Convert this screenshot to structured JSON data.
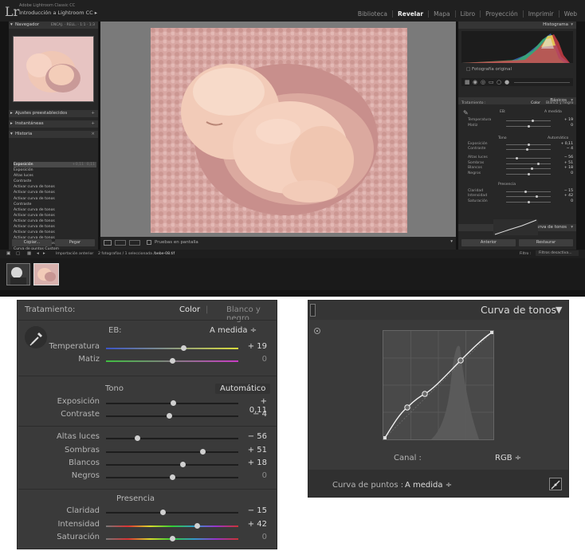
{
  "app": {
    "product": "Adobe Lightroom Classic CC",
    "catalog": "Introducción a Lightroom CC",
    "modules": [
      "Biblioteca",
      "Revelar",
      "Mapa",
      "Libro",
      "Proyección",
      "Imprimir",
      "Web"
    ],
    "active_module": "Revelar"
  },
  "left_panel": {
    "navigator": {
      "title": "Navegador",
      "zoom_options": [
        "ENCAJ.",
        "RELL.",
        "1:1",
        "1:3"
      ]
    },
    "presets_title": "Ajustes preestablecidos",
    "snapshots_title": "Instantáneas",
    "history_title": "Historia",
    "history": [
      {
        "label": "Exposición",
        "v1": "+0,11",
        "v2": "0,11",
        "selected": true
      },
      {
        "label": "Exposición",
        "v1": "",
        "v2": ""
      },
      {
        "label": "Altas luces",
        "v1": "",
        "v2": ""
      },
      {
        "label": "Contraste",
        "v1": "",
        "v2": ""
      },
      {
        "label": "Activar curva de tonos",
        "v1": "",
        "v2": ""
      },
      {
        "label": "Activar curva de tonos",
        "v1": "",
        "v2": ""
      },
      {
        "label": "Activar curva de tonos",
        "v1": "",
        "v2": ""
      },
      {
        "label": "Contraste",
        "v1": "",
        "v2": ""
      },
      {
        "label": "Activar curva de tonos",
        "v1": "",
        "v2": ""
      },
      {
        "label": "Activar curva de tonos",
        "v1": "",
        "v2": ""
      },
      {
        "label": "Activar curva de tonos",
        "v1": "",
        "v2": ""
      },
      {
        "label": "Activar curva de tonos",
        "v1": "",
        "v2": ""
      },
      {
        "label": "Activar curva de tonos",
        "v1": "",
        "v2": ""
      },
      {
        "label": "Activar curva de tonos",
        "v1": "",
        "v2": ""
      },
      {
        "label": "Activar curva de tonos",
        "v1": "",
        "v2": ""
      },
      {
        "label": "Curva de puntos Custom",
        "v1": "",
        "v2": ""
      }
    ],
    "copy_button": "Copiar...",
    "paste_button": "Pegar"
  },
  "toolbar": {
    "soft_proof": "Pruebas en pantalla"
  },
  "filmstrip": {
    "source": "Importación anterior",
    "count": "2 fotografías / 1 seleccionada /",
    "filename": "bebe-08.tif",
    "filter_label": "Filtro :",
    "filter_value": "Filtros desactiva..."
  },
  "right_panel": {
    "histogram_title": "Histograma",
    "original_photo": "Fotografía original",
    "basics_title": "Básicos",
    "treatment_label": "Tratamiento :",
    "treatment_color": "Color",
    "treatment_bw": "Blanco y negro",
    "wb_label": "EB:",
    "wb_value": "A medida",
    "rows": [
      {
        "label": "Temperatura",
        "value": "+ 19"
      },
      {
        "label": "Matiz",
        "value": "0"
      },
      {
        "label": "Exposición",
        "value": "+ 0,11"
      },
      {
        "label": "Contraste",
        "value": "− 4"
      },
      {
        "label": "Altas luces",
        "value": "− 56"
      },
      {
        "label": "Sombras",
        "value": "+ 51"
      },
      {
        "label": "Blancos",
        "value": "+ 18"
      },
      {
        "label": "Negros",
        "value": "0"
      },
      {
        "label": "Claridad",
        "value": "− 15"
      },
      {
        "label": "Intensidad",
        "value": "+ 42"
      },
      {
        "label": "Saturación",
        "value": "0"
      }
    ],
    "tone_label": "Tono",
    "auto_label": "Automático",
    "presence_label": "Presencia",
    "curve_title": "Curva de tonos",
    "previous_button": "Anterior",
    "reset_button": "Restaurar"
  },
  "basic_panel": {
    "treatment_label": "Tratamiento:",
    "treatment_color": "Color",
    "treatment_divider": "|",
    "treatment_bw": "Blanco y negro",
    "wb_label": "EB:",
    "wb_value": "A medida ÷",
    "tone_label": "Tono",
    "auto_label": "Automático",
    "presence_label": "Presencia",
    "sliders": [
      {
        "label": "Temperatura",
        "value": "+ 19",
        "level": 0.59,
        "track": "temp"
      },
      {
        "label": "Matiz",
        "value": "0",
        "level": 0.5,
        "track": "tint"
      },
      {
        "label": "Exposición",
        "value": "+ 0,11",
        "level": 0.51,
        "track": "gray"
      },
      {
        "label": "Contraste",
        "value": "− 4",
        "level": 0.48,
        "track": "gray"
      },
      {
        "label": "Altas luces",
        "value": "− 56",
        "level": 0.24,
        "track": "gray"
      },
      {
        "label": "Sombras",
        "value": "+ 51",
        "level": 0.73,
        "track": "gray"
      },
      {
        "label": "Blancos",
        "value": "+ 18",
        "level": 0.58,
        "track": "gray"
      },
      {
        "label": "Negros",
        "value": "0",
        "level": 0.5,
        "track": "gray"
      },
      {
        "label": "Claridad",
        "value": "− 15",
        "level": 0.43,
        "track": "gray"
      },
      {
        "label": "Intensidad",
        "value": "+ 42",
        "level": 0.69,
        "track": "rainbow"
      },
      {
        "label": "Saturación",
        "value": "0",
        "level": 0.5,
        "track": "rainbow"
      }
    ]
  },
  "curve_panel": {
    "title": "Curva de tonos",
    "channel_label": "Canal :",
    "channel_value": "RGB ÷",
    "point_curve_label": "Curva de puntos :",
    "point_curve_value": "A medida ÷"
  },
  "colors": {
    "accent": "#dcdcdc",
    "panel_bg": "#3a3a3a",
    "app_bg": "#141414"
  }
}
